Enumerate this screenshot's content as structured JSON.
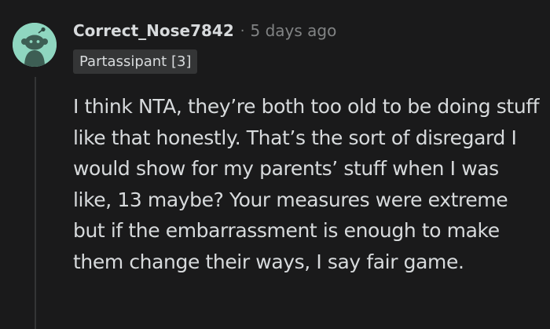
{
  "comment": {
    "author": "Correct_Nose7842",
    "separator": "·",
    "timestamp": "5 days ago",
    "flair": "Partassipant [3]",
    "body": "I think NTA, they’re both too old to be doing stuff like that honestly. That’s the sort of disregard I would show for my parents’ stuff when I was like, 13 maybe? Your measures were extreme but if the embarrassment is enough to make them change their ways, I say fair game."
  },
  "icons": {
    "avatar": "snoo-avatar-icon"
  },
  "colors": {
    "background": "#1a1a1b",
    "avatar_bg": "#8fd6c0",
    "text": "#d7dadc",
    "muted": "#818384",
    "flair_bg": "#343536",
    "thread_line": "#343536"
  }
}
